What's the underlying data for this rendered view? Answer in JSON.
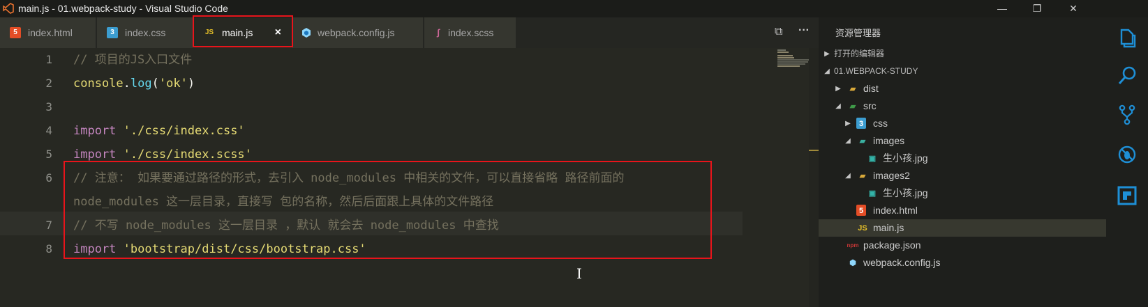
{
  "window": {
    "title": "main.js - 01.webpack-study - Visual Studio Code",
    "controls": [
      "—",
      "❐",
      "✕"
    ]
  },
  "tabs": [
    {
      "label": "index.html",
      "icon": "html-file-icon",
      "color": "#e44d26"
    },
    {
      "label": "index.css",
      "icon": "css-file-icon",
      "color": "#3c9dd0"
    },
    {
      "label": "main.js",
      "icon": "js-file-icon",
      "color": "#e6c029",
      "active": true,
      "close": "×"
    },
    {
      "label": "webpack.config.js",
      "icon": "webpack-icon",
      "color": "#8ed6fb"
    },
    {
      "label": "index.scss",
      "icon": "sass-icon",
      "color": "#cd6799"
    }
  ],
  "editor_actions": {
    "split": "⧉",
    "more": "···"
  },
  "code_lines": [
    {
      "num": "1",
      "tokens": [
        {
          "t": "// 项目的JS入口文件",
          "c": "comment"
        }
      ]
    },
    {
      "num": "2",
      "tokens": [
        {
          "t": "console",
          "c": "id"
        },
        {
          "t": ".",
          "c": "text"
        },
        {
          "t": "log",
          "c": "fn"
        },
        {
          "t": "(",
          "c": "text"
        },
        {
          "t": "'ok'",
          "c": "str"
        },
        {
          "t": ")",
          "c": "text"
        }
      ]
    },
    {
      "num": "3",
      "tokens": []
    },
    {
      "num": "4",
      "tokens": [
        {
          "t": "import",
          "c": "kw"
        },
        {
          "t": " ",
          "c": "text"
        },
        {
          "t": "'./css/index.css'",
          "c": "str"
        }
      ]
    },
    {
      "num": "5",
      "tokens": [
        {
          "t": "import",
          "c": "kw"
        },
        {
          "t": " ",
          "c": "text"
        },
        {
          "t": "'./css/index.scss'",
          "c": "str"
        }
      ]
    },
    {
      "num": "6",
      "tokens": [
        {
          "t": "// 注意： 如果要通过路径的形式，去引入 node_modules 中相关的文件，可以直接省略 路径前面的",
          "c": "comment"
        }
      ]
    },
    {
      "num": "",
      "tokens": [
        {
          "t": "node_modules 这一层目录，直接写 包的名称，然后后面跟上具体的文件路径",
          "c": "comment"
        }
      ]
    },
    {
      "num": "7",
      "tokens": [
        {
          "t": "// 不写 node_modules 这一层目录 ，默认 就会去 node_modules 中查找",
          "c": "comment"
        }
      ]
    },
    {
      "num": "8",
      "tokens": [
        {
          "t": "import",
          "c": "kw"
        },
        {
          "t": " ",
          "c": "text"
        },
        {
          "t": "'bootstrap/dist/css/bootstrap.css'",
          "c": "str"
        }
      ]
    }
  ],
  "explorer": {
    "title": "资源管理器",
    "sections": {
      "open_editors": "打开的编辑器",
      "project": "01.WEBPACK-STUDY"
    },
    "items": [
      {
        "label": "dist",
        "icon": "folder-icon",
        "arrow": "▶",
        "depth": 1
      },
      {
        "label": "src",
        "icon": "src-folder-icon",
        "arrow": "◢",
        "depth": 1
      },
      {
        "label": "css",
        "icon": "css-folder-icon",
        "arrow": "▶",
        "depth": 2
      },
      {
        "label": "images",
        "icon": "images-folder-icon",
        "arrow": "◢",
        "depth": 2
      },
      {
        "label": "生小孩.jpg",
        "icon": "image-file-icon",
        "arrow": "",
        "depth": 3
      },
      {
        "label": "images2",
        "icon": "folder-open-icon",
        "arrow": "◢",
        "depth": 2
      },
      {
        "label": "生小孩.jpg",
        "icon": "image-file-icon",
        "arrow": "",
        "depth": 3
      },
      {
        "label": "index.html",
        "icon": "html-file-icon",
        "arrow": "",
        "depth": 2
      },
      {
        "label": "main.js",
        "icon": "js-file-icon",
        "arrow": "",
        "depth": 2,
        "selected": true
      },
      {
        "label": "package.json",
        "icon": "npm-icon",
        "arrow": "",
        "depth": 1
      },
      {
        "label": "webpack.config.js",
        "icon": "webpack-icon",
        "arrow": "",
        "depth": 1
      }
    ]
  },
  "activity_bar": [
    "files-icon",
    "search-icon",
    "source-control-icon",
    "debug-icon",
    "extensions-icon"
  ],
  "colors": {
    "accent": "#1e8fd6",
    "highlight_box": "#e8141b"
  }
}
